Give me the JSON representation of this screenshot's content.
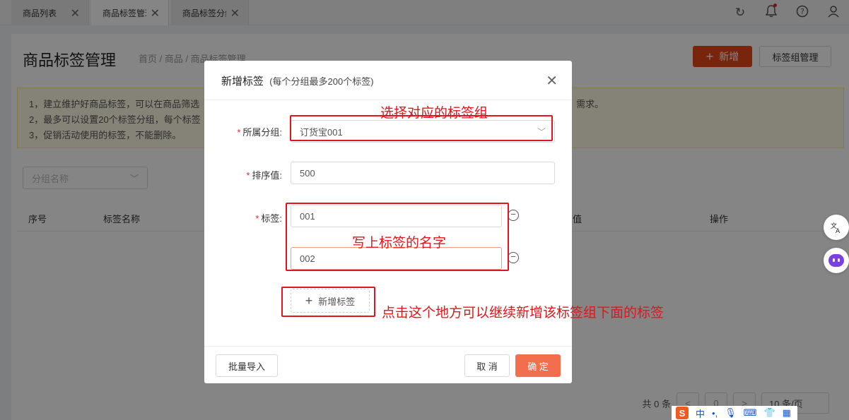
{
  "tabs": [
    {
      "label": "商品列表"
    },
    {
      "label": "商品标签管理"
    },
    {
      "label": "商品标签分组"
    }
  ],
  "page": {
    "title": "商品标签管理",
    "breadcrumb": "首页 / 商品 / 商品标签管理",
    "new_button": "新增",
    "group_button": "标签组管理"
  },
  "notice": {
    "line1": "1，建立维护好商品标签，可以在商品筛选",
    "line1_tail": "需求。",
    "line2": "2，最多可以设置20个标签分组，每个标签",
    "line3": "3，促销活动使用的标签，不能删除。"
  },
  "filter": {
    "placeholder": "分组名称"
  },
  "table": {
    "col_index": "序号",
    "col_name": "标签名称",
    "col_value": "值",
    "col_ops": "操作"
  },
  "pager": {
    "total": "共 0 条",
    "prev": "<",
    "page": "0",
    "next": ">",
    "size": "10 条/页"
  },
  "modal": {
    "title": "新增标签",
    "subtitle": "(每个分组最多200个标签)",
    "close": "X",
    "group_label": "所属分组:",
    "group_value": "订货宝001",
    "sort_label": "排序值:",
    "sort_value": "500",
    "tag_label": "标签:",
    "tags": [
      "001",
      "002"
    ],
    "add_tag": "新增标签",
    "import_button": "批量导入",
    "cancel_button": "取 消",
    "ok_button": "确 定"
  },
  "annotations": {
    "select_group": "选择对应的标签组",
    "write_name": "写上标签的名字",
    "click_add": "点击这个地方可以继续新增该标签组下面的标签"
  },
  "ime": {
    "zh": "中"
  },
  "colors": {
    "accent": "#e8481b",
    "ok_button": "#f36e4d",
    "annotation_red": "#e3141b",
    "notice_bg": "#fffbe6"
  }
}
